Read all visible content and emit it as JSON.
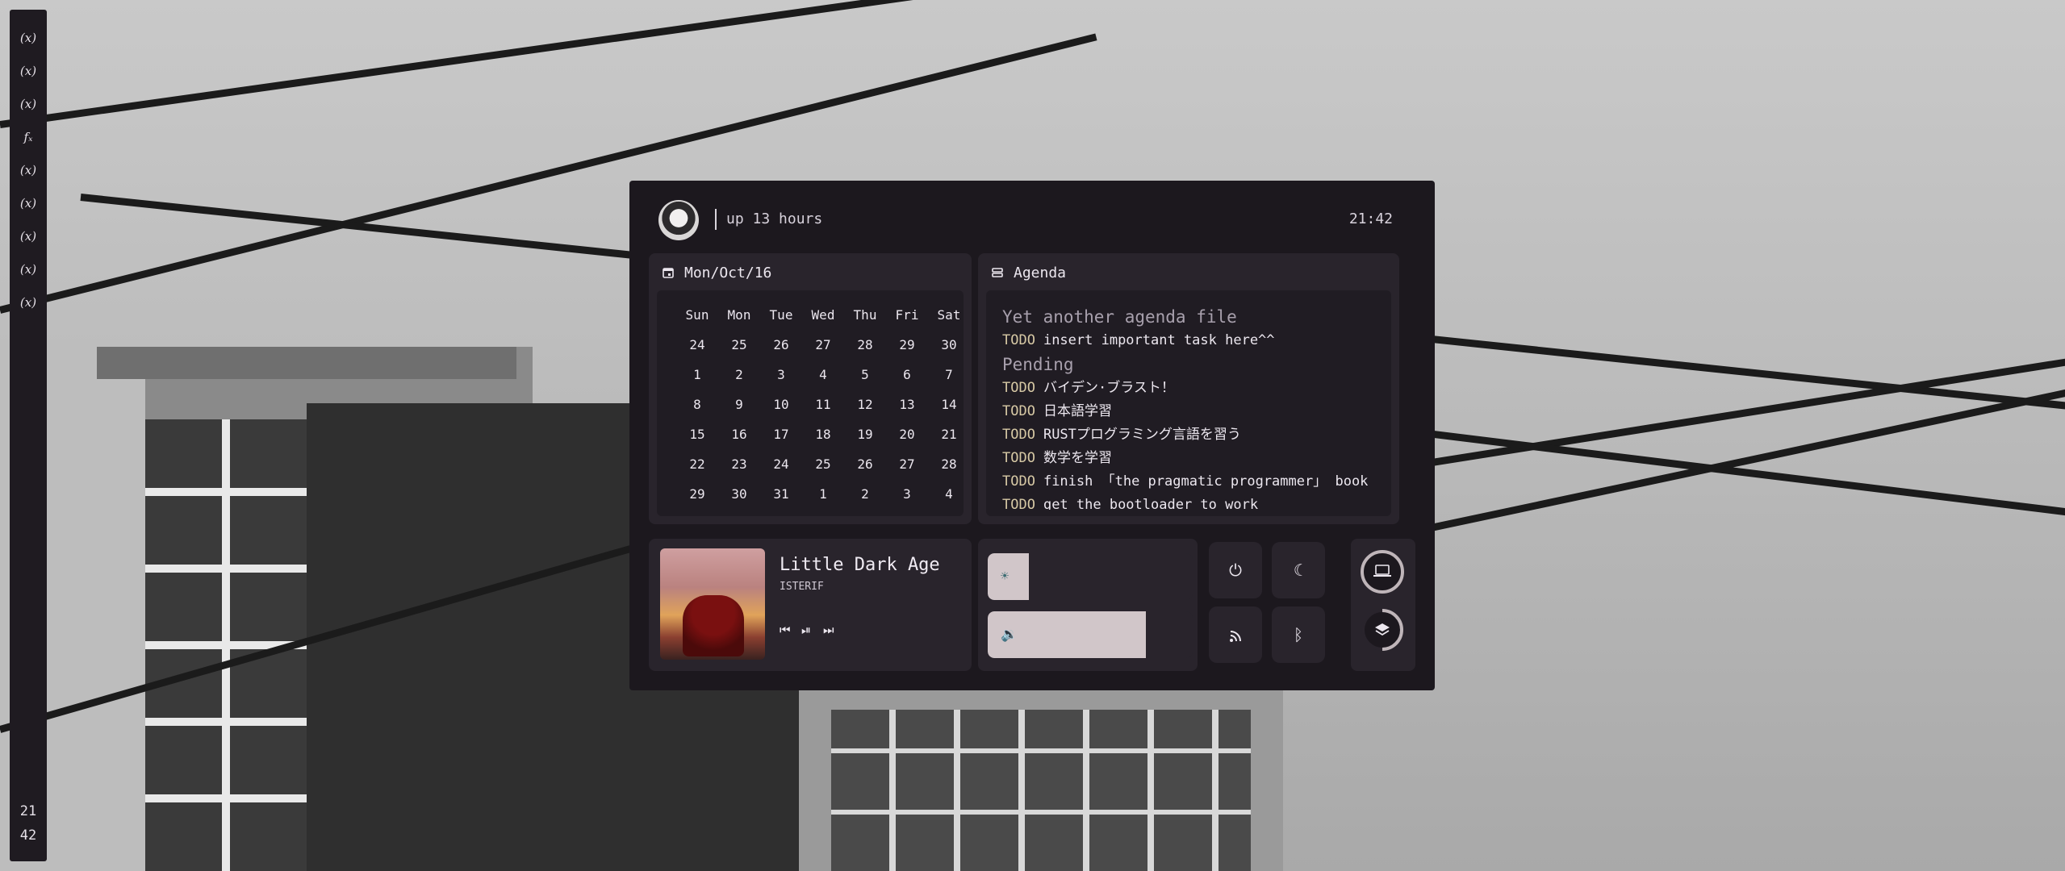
{
  "sidebar": {
    "workspaces": [
      "(x)",
      "(x)",
      "(x)",
      "𝑓ₓ",
      "(x)",
      "(x)",
      "(x)",
      "(x)",
      "(x)"
    ],
    "clock_hour": "21",
    "clock_minute": "42"
  },
  "header": {
    "uptime": "up 13 hours",
    "time": "21:42"
  },
  "calendar": {
    "title": "Mon/Oct/16",
    "weekdays": [
      "Sun",
      "Mon",
      "Tue",
      "Wed",
      "Thu",
      "Fri",
      "Sat"
    ],
    "days": [
      "24",
      "25",
      "26",
      "27",
      "28",
      "29",
      "30",
      "1",
      "2",
      "3",
      "4",
      "5",
      "6",
      "7",
      "8",
      "9",
      "10",
      "11",
      "12",
      "13",
      "14",
      "15",
      "16",
      "17",
      "18",
      "19",
      "20",
      "21",
      "22",
      "23",
      "24",
      "25",
      "26",
      "27",
      "28",
      "29",
      "30",
      "31",
      "1",
      "2",
      "3",
      "4"
    ]
  },
  "agenda": {
    "title": "Agenda",
    "lines": [
      {
        "type": "heading",
        "text": "Yet another agenda file"
      },
      {
        "type": "todo",
        "keyword": "TODO",
        "text": "insert important task here^^"
      },
      {
        "type": "heading",
        "text": "Pending"
      },
      {
        "type": "todo",
        "keyword": "TODO",
        "text": "バイデン·ブラスト！"
      },
      {
        "type": "todo",
        "keyword": "TODO",
        "text": "日本語学習"
      },
      {
        "type": "todo",
        "keyword": "TODO",
        "text": "RUSTプログラミング言語を習う"
      },
      {
        "type": "todo",
        "keyword": "TODO",
        "text": "数学を学習"
      },
      {
        "type": "todo",
        "keyword": "TODO",
        "text": "finish 「the pragmatic programmer」 book"
      },
      {
        "type": "todo",
        "keyword": "TODO",
        "text": "get the bootloader to work"
      }
    ]
  },
  "media": {
    "title": "Little Dark Age",
    "artist": "ISTERIF",
    "prev_icon": "⏮",
    "play_pause_icon": "⏯",
    "next_icon": "⏭"
  },
  "controls": {
    "brightness_level": 0.2,
    "volume_level": 0.77,
    "power_icon": "⏻",
    "night_icon": "☾",
    "rss_icon": "))",
    "bluetooth_icon": "ᛒ",
    "laptop_icon": "▭",
    "layers_icon": "◈",
    "accent": "#d1c6c9"
  }
}
